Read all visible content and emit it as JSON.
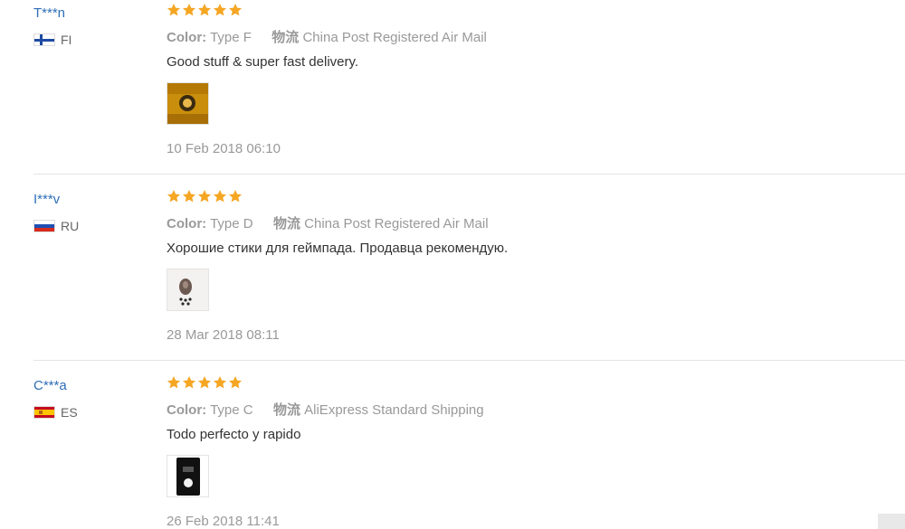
{
  "reviews": [
    {
      "user": "T***n",
      "country_code": "FI",
      "flag_icon": "finland-flag-icon",
      "rating": 5,
      "color_label": "Color:",
      "color_value": "Type F",
      "shipping_label": "物流",
      "shipping_value": "China Post Registered Air Mail",
      "text": "Good stuff & super fast delivery.",
      "date": "10 Feb 2018 06:10"
    },
    {
      "user": "I***v",
      "country_code": "RU",
      "flag_icon": "russia-flag-icon",
      "rating": 5,
      "color_label": "Color:",
      "color_value": "Type D",
      "shipping_label": "物流",
      "shipping_value": "China Post Registered Air Mail",
      "text": "Хорошие стики для геймпада. Продавца рекомендую.",
      "date": "28 Mar 2018 08:11"
    },
    {
      "user": "C***a",
      "country_code": "ES",
      "flag_icon": "spain-flag-icon",
      "rating": 5,
      "color_label": "Color:",
      "color_value": "Type C",
      "shipping_label": "物流",
      "shipping_value": "AliExpress Standard Shipping",
      "text": "Todo perfecto y rapido",
      "date": "26 Feb 2018 11:41"
    }
  ],
  "colors": {
    "username": "#2f6eb8",
    "star": "#f5a623",
    "muted_text": "#999999",
    "body_text": "#333333"
  }
}
